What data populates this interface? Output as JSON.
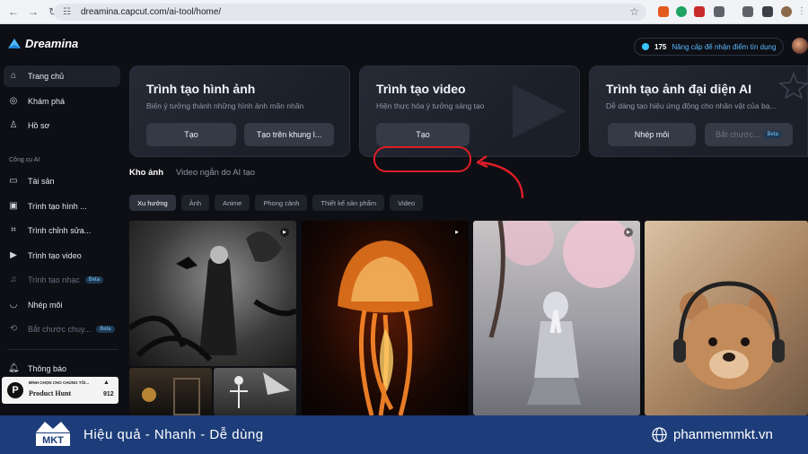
{
  "browser": {
    "url": "dreamina.capcut.com/ai-tool/home/"
  },
  "header": {
    "logo_text": "Dreamina",
    "credits": "175",
    "upgrade_text": "Nâng cấp để nhận điểm tín dụng"
  },
  "sidebar": {
    "items": [
      {
        "label": "Trang chủ"
      },
      {
        "label": "Khám phá"
      },
      {
        "label": "Hồ sơ"
      }
    ],
    "section_label": "Công cụ AI",
    "tools": [
      {
        "label": "Tài sản"
      },
      {
        "label": "Trình tạo hình ..."
      },
      {
        "label": "Trình chỉnh sửa..."
      },
      {
        "label": "Trình tạo video"
      },
      {
        "label": "Trình tạo nhạc",
        "badge": "Beta"
      },
      {
        "label": "Nhép môi"
      },
      {
        "label": "Bắt chước chuy...",
        "badge": "Beta"
      }
    ],
    "notifications": "Thông báo",
    "product_hunt": {
      "tagline": "BÌNH CHỌN CHO CHÚNG TÔI...",
      "name": "Product Hunt",
      "count": "912"
    }
  },
  "cards": [
    {
      "title": "Trình tạo hình ảnh",
      "desc": "Biến ý tưởng thành những hình ảnh mãn nhãn",
      "btn1": "Tạo",
      "btn2": "Tạo trên khung l..."
    },
    {
      "title": "Trình tạo video",
      "desc": "Hiện thực hóa ý tưởng sáng tạo",
      "btn1": "Tạo"
    },
    {
      "title": "Trình tạo ảnh đại diện AI",
      "desc": "Dễ dàng tạo hiệu ứng động cho nhân vật của bạ...",
      "btn1": "Nhép môi",
      "btn2": "Bắt chước...",
      "btn2_badge": "Beta"
    }
  ],
  "tabs": [
    {
      "label": "Kho ảnh"
    },
    {
      "label": "Video ngắn do AI tạo"
    }
  ],
  "chips": [
    {
      "label": "Xu hướng"
    },
    {
      "label": "Ảnh"
    },
    {
      "label": "Anime"
    },
    {
      "label": "Phong cảnh"
    },
    {
      "label": "Thiết kế sản phẩm"
    },
    {
      "label": "Video"
    }
  ],
  "footer": {
    "brand": "MKT",
    "slogan": "Hiệu quả - Nhanh - Dễ dùng",
    "site": "phanmemmkt.vn"
  },
  "colors": {
    "accent_highlight": "#e11d27",
    "footer_bg": "#1d3d7a",
    "beta_badge": "#7cc4ff"
  }
}
